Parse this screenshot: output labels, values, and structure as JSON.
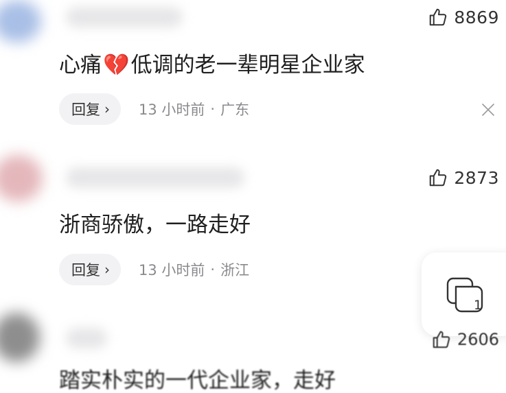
{
  "comments": [
    {
      "likes": "8869",
      "text_before": "心痛",
      "emoji": "💔",
      "text_after": "低调的老一辈明星企业家",
      "reply_label": "回复",
      "time": "13 小时前",
      "separator": "·",
      "location": "广东"
    },
    {
      "likes": "2873",
      "text": "浙商骄傲，一路走好",
      "reply_label": "回复",
      "time": "13 小时前",
      "separator": "·",
      "location": "浙江"
    },
    {
      "likes": "2606",
      "text": "踏实朴实的一代企业家，走好"
    }
  ],
  "float_button": {
    "count": "1"
  },
  "colors": {
    "meta_gray": "#8a8a8e",
    "reply_bg": "#f2f2f4"
  }
}
